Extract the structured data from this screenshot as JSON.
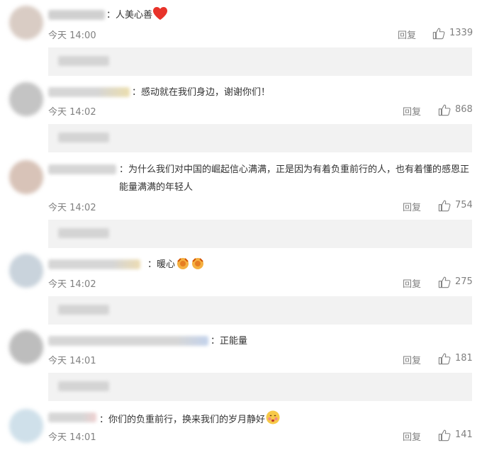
{
  "comments": [
    {
      "text": "：人美心善",
      "time": "今天 14:00",
      "reply": "回复",
      "likes": "1339",
      "emoji": "heart-icon"
    },
    {
      "text": "：感动就在我们身边，谢谢你们！",
      "time": "今天 14:02",
      "reply": "回复",
      "likes": "868"
    },
    {
      "text": "：为什么我们对中国的崛起信心满满，正是因为有着负重前行的人，也有着懂的感恩正能量满满的年轻人",
      "time": "今天 14:02",
      "reply": "回复",
      "likes": "754"
    },
    {
      "text": "：暖心",
      "time": "今天 14:02",
      "reply": "回复",
      "likes": "275",
      "emoji": "salute-emoji-icon"
    },
    {
      "text": "：正能量",
      "time": "今天 14:01",
      "reply": "回复",
      "likes": "181"
    },
    {
      "text": "：你们的负重前行，换来我们的岁月静好",
      "time": "今天 14:01",
      "reply": "回复",
      "likes": "141",
      "emoji": "blush-emoji-icon"
    }
  ],
  "colors": {
    "accent_heart": "#e8332a",
    "meta": "#808080",
    "reply_bg": "#f2f2f2"
  }
}
